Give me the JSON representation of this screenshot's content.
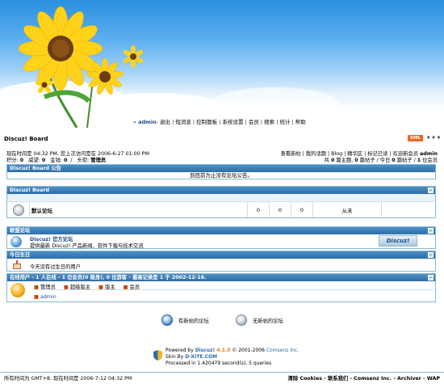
{
  "nav": {
    "user": "admin",
    "items": [
      "退出",
      "短消息",
      "控制面板",
      "系统设置",
      "会员",
      "搜索",
      "统计",
      "帮助"
    ]
  },
  "board_title": "Discuz! Board",
  "xml_badge": "XML",
  "info": {
    "time_line": "现在时间是 04:32 PM, 您上次访问是在 2006-6-27 01:00 PM",
    "credits": {
      "label_points": "积分:",
      "points": "0",
      "label_prestige": "威望:",
      "prestige": "0",
      "label_money": "金钱:",
      "money": "0",
      "label_title": "头衔:",
      "title": "管理员"
    },
    "links": [
      "查看新帖",
      "我的话题",
      "Blog",
      "精华区",
      "标记已读"
    ],
    "welcome_prefix": "欢迎新会员",
    "welcome_user": "admin",
    "stats": {
      "prefix": "共",
      "topics": "0",
      "topics_label": "篇主题",
      "posts": "0",
      "posts_label": "篇帖子",
      "today_prefix": "今日",
      "today": "0",
      "today_label": "篇帖子",
      "members": "1",
      "members_label": "位会员"
    }
  },
  "announcement": {
    "title": "Discuz! Board 公告",
    "text": "到目前为止没有论坛公告。"
  },
  "forum_section": {
    "title": "Discuz! Board",
    "forum_name": "默认论坛",
    "topics": "0",
    "posts": "0",
    "today": "0",
    "last_post": "从未"
  },
  "links_section": {
    "title": "联盟论坛",
    "name": "Discuz! 官方论坛",
    "desc": "提供最新 Discuz! 产品新闻、软件下载与技术交流",
    "logo_text": "Discuz!"
  },
  "birthday_section": {
    "title": "今日生日",
    "text": "今天没有过生日的用户"
  },
  "online_section": {
    "title": "在线用户 - 1 人在线 - 1 位会员(0 隐身), 0 位游客 - 最高记录是 1 于 2002-12-16.",
    "legend": [
      "管理员",
      "超级版主",
      "版主",
      "会员"
    ],
    "users": [
      "admin"
    ]
  },
  "legend": {
    "new": "有新帖的论坛",
    "none": "无新帖的论坛"
  },
  "footer": {
    "powered": "Powered by",
    "product": "Discuz!",
    "version": "4.1.0",
    "copyright": "© 2001-2006",
    "company": "Comsenz Inc.",
    "skin_prefix": "Skin By",
    "skin_by": "D-XITE.COM",
    "processed": "Processed in 1.420479 second(s), 5 queries"
  },
  "bottombar": {
    "left": "所有时间为 GMT+8, 现在时间是 2006-7-12 04:32 PM",
    "links": [
      "清除 Cookies",
      "联系我们",
      "Comsenz Inc.",
      "Archiver",
      "WAP"
    ]
  },
  "colors": {
    "header_blue": "#2e6ea8",
    "border_blue": "#86b9d6",
    "xml_orange": "#f26522"
  }
}
